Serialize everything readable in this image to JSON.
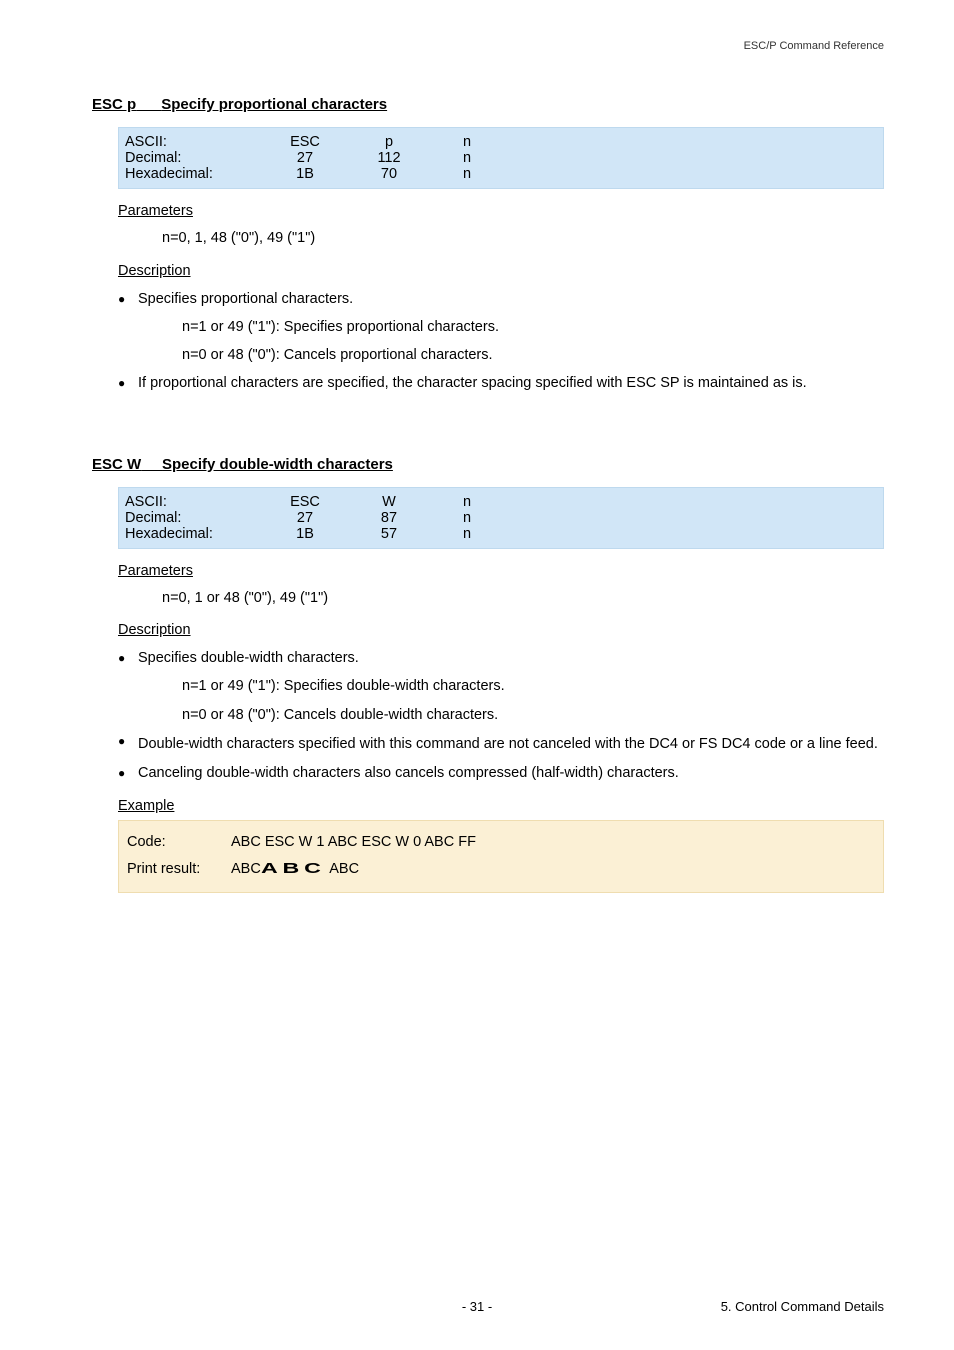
{
  "header": {
    "doc_title": "ESC/P Command Reference"
  },
  "sections": [
    {
      "title_cmd": "ESC p",
      "title_text": "Specify proportional characters",
      "code_rows": [
        {
          "c0": "ASCII:",
          "c1": "ESC",
          "c2": "p",
          "c3": "n"
        },
        {
          "c0": "Decimal:",
          "c1": "27",
          "c2": "112",
          "c3": "n"
        },
        {
          "c0": "Hexadecimal:",
          "c1": "1B",
          "c2": "70",
          "c3": "n"
        }
      ],
      "params_heading": "Parameters",
      "params_line": "n=0, 1, 48 (\"0\"), 49 (\"1\")",
      "desc_heading": "Description",
      "bullets": [
        {
          "text": "Specifies proportional characters.",
          "subs": [
            "n=1 or 49 (\"1\"): Specifies proportional characters.",
            "n=0 or 48 (\"0\"): Cancels proportional characters."
          ]
        },
        {
          "text": "If proportional characters are specified, the character spacing specified with ESC SP is maintained as is.",
          "subs": []
        }
      ]
    },
    {
      "title_cmd": "ESC W",
      "title_text": "Specify double-width characters",
      "code_rows": [
        {
          "c0": "ASCII:",
          "c1": "ESC",
          "c2": "W",
          "c3": "n"
        },
        {
          "c0": "Decimal:",
          "c1": "27",
          "c2": "87",
          "c3": "n"
        },
        {
          "c0": "Hexadecimal:",
          "c1": "1B",
          "c2": "57",
          "c3": "n"
        }
      ],
      "params_heading": "Parameters",
      "params_line": "n=0, 1 or 48 (\"0\"), 49 (\"1\")",
      "desc_heading": "Description",
      "bullets": [
        {
          "text": "Specifies double-width characters.",
          "subs": [
            "n=1 or 49 (\"1\"): Specifies double-width characters.",
            "n=0 or 48 (\"0\"): Cancels double-width characters."
          ]
        },
        {
          "text": "Double-width characters specified with this command are not canceled with the DC4 or FS DC4 code or a line feed.",
          "subs": []
        },
        {
          "text": "Canceling double-width characters also cancels compressed (half-width) characters.",
          "subs": []
        }
      ],
      "example_heading": "Example",
      "example": {
        "code_label": "Code:",
        "code_value": "ABC ESC W 1 ABC ESC W 0 ABC FF",
        "print_label": "Print result:",
        "print_seg1": "ABC",
        "print_seg2": "ABC",
        "print_seg3": "ABC"
      }
    }
  ],
  "footer": {
    "center": "- 31 -",
    "right": "5. Control Command Details"
  }
}
